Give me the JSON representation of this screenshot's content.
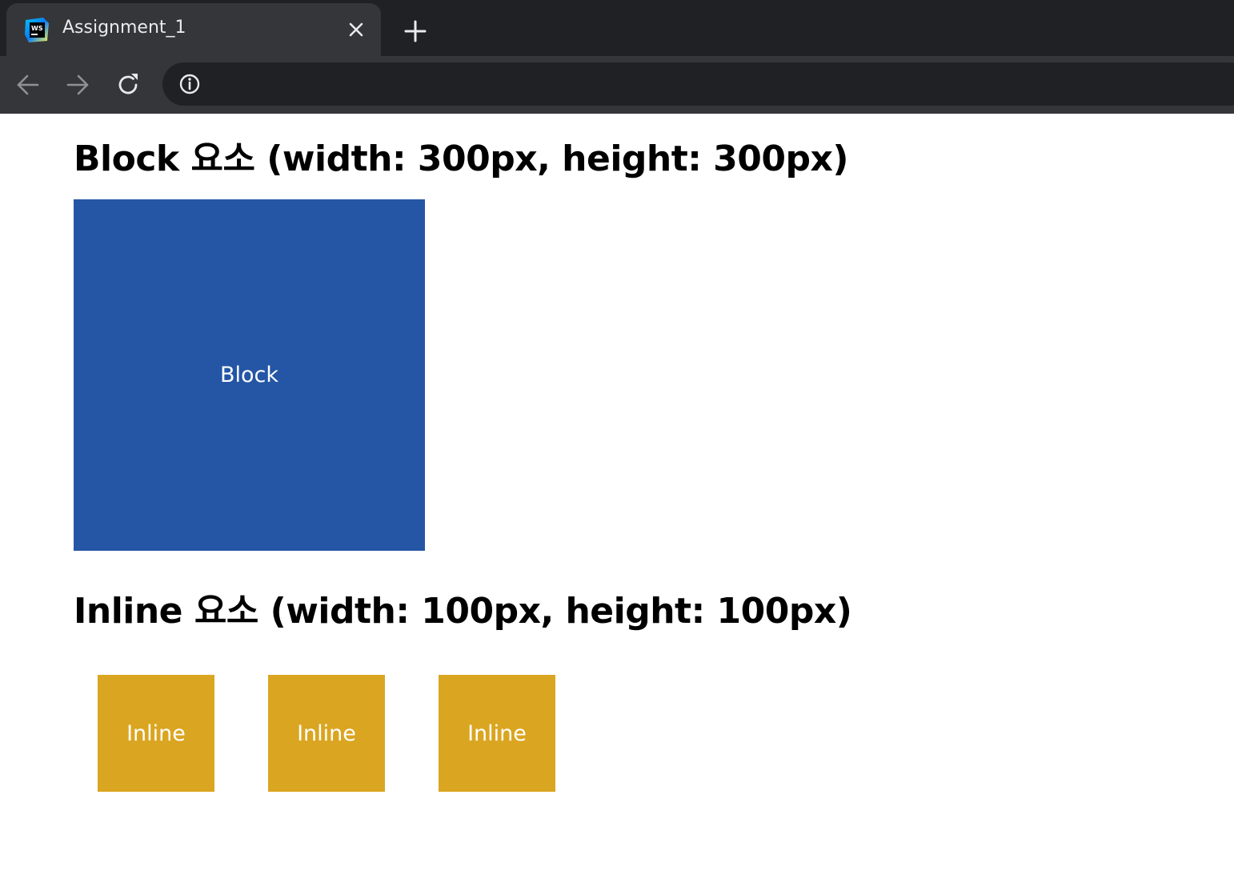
{
  "browser": {
    "tab": {
      "title": "Assignment_1",
      "favicon": "webstorm-icon",
      "close_icon": "close-icon"
    },
    "new_tab_icon": "plus-icon",
    "toolbar": {
      "back_icon": "arrow-left-icon",
      "forward_icon": "arrow-right-icon",
      "reload_icon": "reload-icon",
      "info_icon": "info-icon",
      "address_value": ""
    }
  },
  "page": {
    "block_heading": "Block 요소 (width: 300px, height: 300px)",
    "block_label": "Block",
    "inline_heading": "Inline 요소 (width: 100px, height: 100px)",
    "inline_items": [
      {
        "label": "Inline"
      },
      {
        "label": "Inline"
      },
      {
        "label": "Inline"
      }
    ]
  },
  "colors": {
    "block_background": "#2456a5",
    "inline_background": "#daa520",
    "chrome_dark": "#202124",
    "chrome_tab": "#35363a"
  }
}
